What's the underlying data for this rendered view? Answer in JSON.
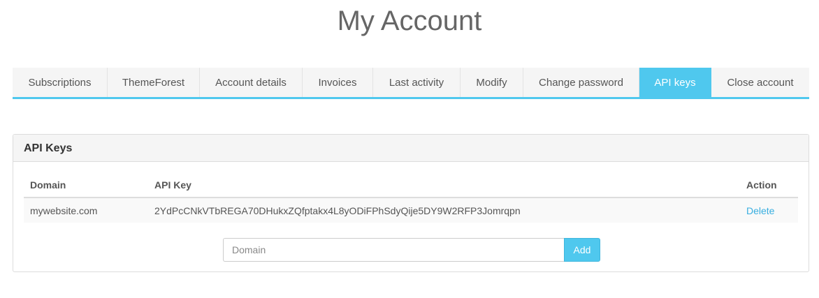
{
  "page": {
    "title": "My Account"
  },
  "tabs": [
    {
      "label": "Subscriptions",
      "active": false
    },
    {
      "label": "ThemeForest",
      "active": false
    },
    {
      "label": "Account details",
      "active": false
    },
    {
      "label": "Invoices",
      "active": false
    },
    {
      "label": "Last activity",
      "active": false
    },
    {
      "label": "Modify",
      "active": false
    },
    {
      "label": "Change password",
      "active": false
    },
    {
      "label": "API keys",
      "active": true
    },
    {
      "label": "Close account",
      "active": false
    }
  ],
  "panel": {
    "title": "API Keys",
    "columns": {
      "domain": "Domain",
      "api_key": "API Key",
      "action": "Action"
    },
    "rows": [
      {
        "domain": "mywebsite.com",
        "api_key": "2YdPcCNkVTbREGA70DHukxZQfptakx4L8yODiFPhSdyQije5DY9W2RFP3Jomrqpn",
        "action": "Delete"
      }
    ],
    "form": {
      "domain_placeholder": "Domain",
      "domain_value": "",
      "add_label": "Add"
    }
  },
  "colors": {
    "accent": "#4fc8ee",
    "link": "#38aee0",
    "tab_bg": "#f5f5f5"
  }
}
